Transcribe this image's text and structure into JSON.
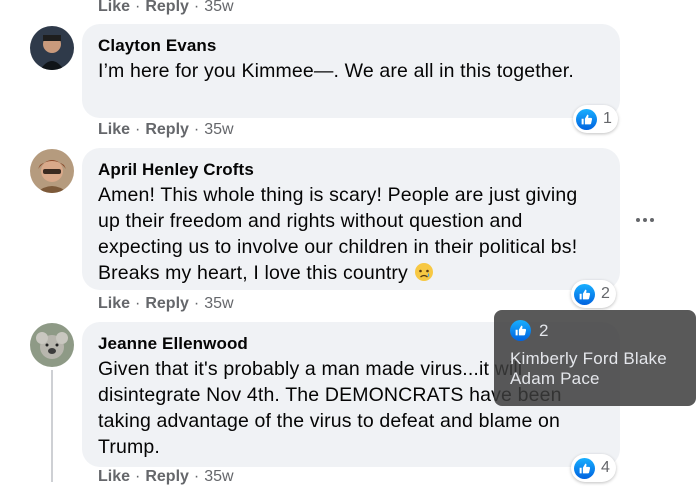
{
  "top_actions": {
    "like": "Like",
    "reply": "Reply",
    "time": "35w"
  },
  "comments": [
    {
      "author": "Clayton Evans",
      "text": "I’m here for you Kimmee—. We are all in this together.",
      "actions": {
        "like": "Like",
        "reply": "Reply",
        "time": "35w"
      },
      "reactions": "1"
    },
    {
      "author": "April Henley Crofts",
      "text": "Amen! This whole thing is scary! People are just giving up their freedom and rights without question and expecting us to involve our children in their political bs! Breaks my heart, I love this country",
      "emoji": "crying-face-emoji",
      "actions": {
        "like": "Like",
        "reply": "Reply",
        "time": "35w"
      },
      "reactions": "2"
    },
    {
      "author": "Jeanne Ellenwood",
      "text": "Given that it's probably a man made virus...it will disintegrate Nov 4th. The DEMONCRATS have been taking advantage of the virus to defeat and blame on Trump.",
      "actions": {
        "like": "Like",
        "reply": "Reply",
        "time": "35w"
      },
      "reactions": "4"
    }
  ],
  "tooltip": {
    "count": "2",
    "names": [
      "Kimberly Ford Blake",
      "Adam Pace"
    ]
  },
  "colors": {
    "like_blue": "#1877f2",
    "bubble_bg": "#f0f2f5",
    "meta_gray": "#65676b"
  }
}
